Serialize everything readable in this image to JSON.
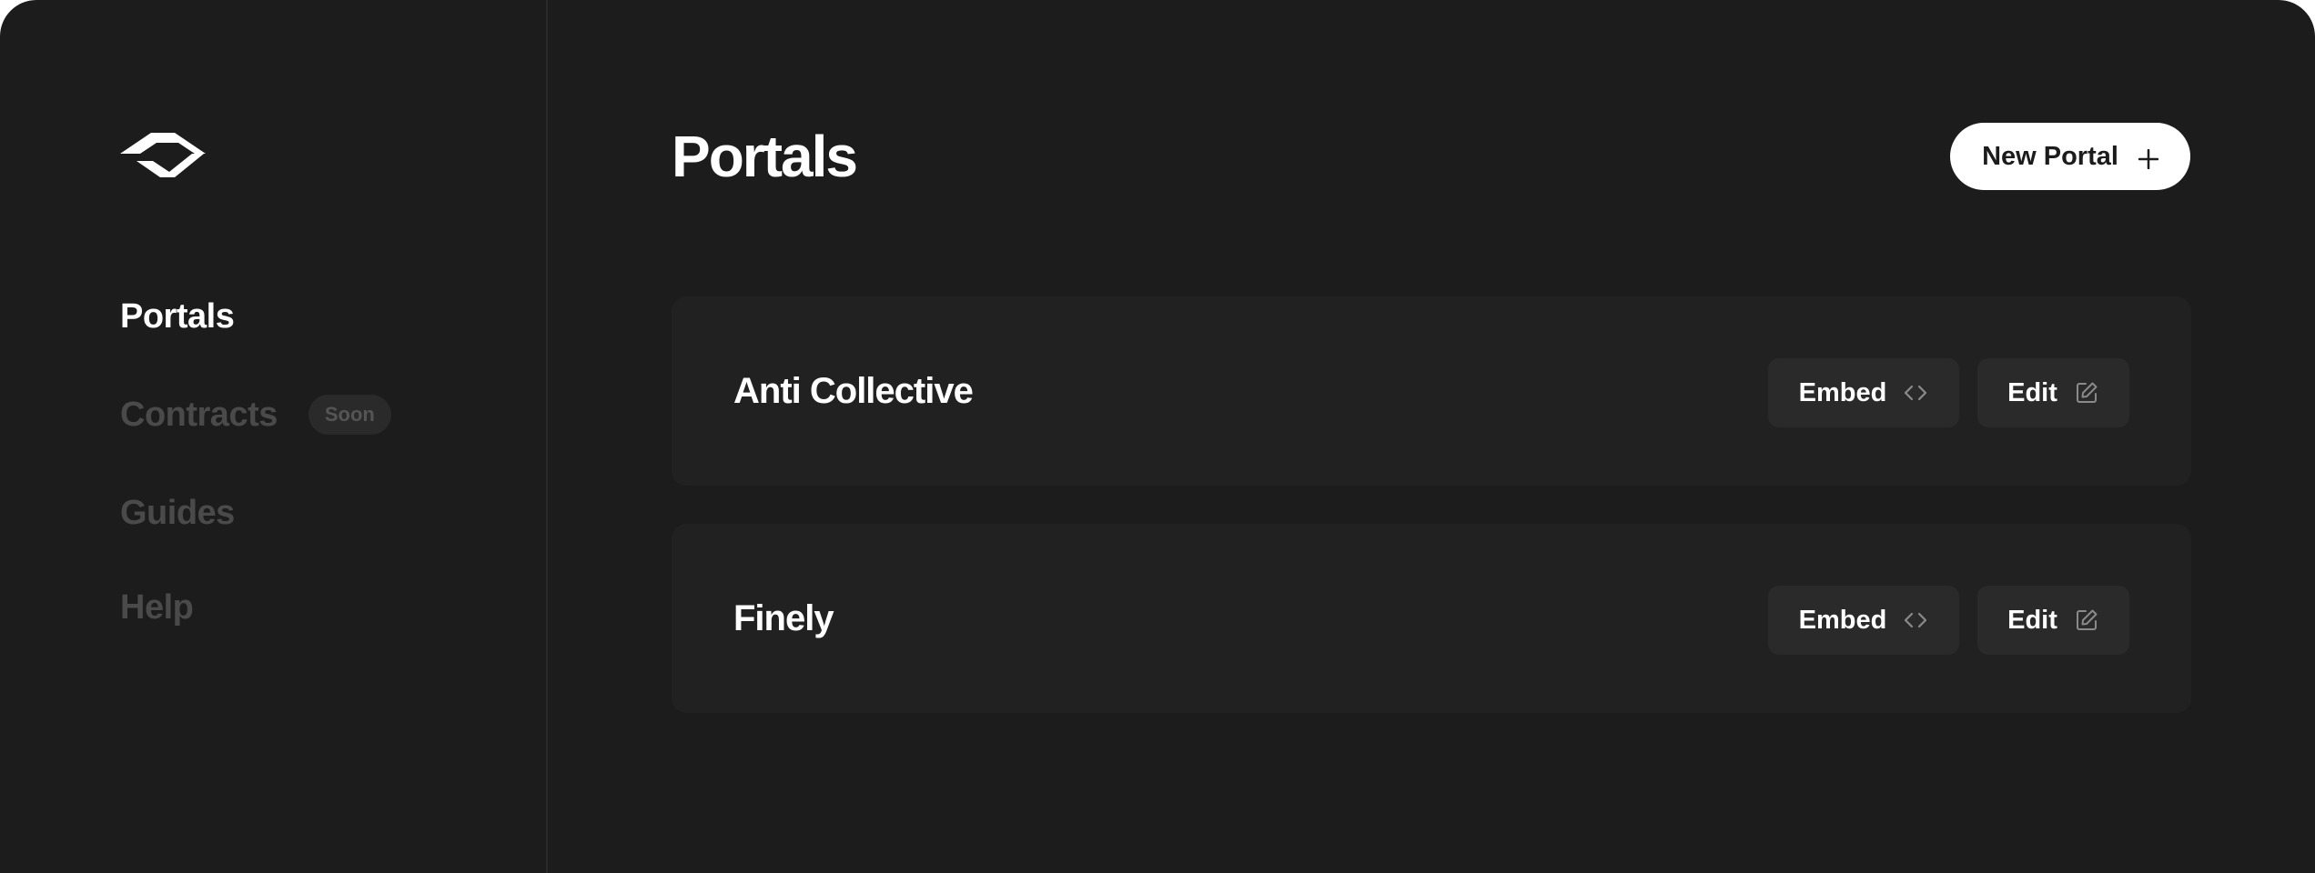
{
  "sidebar": {
    "logo": "portal-logo-icon",
    "items": [
      {
        "label": "Portals",
        "active": true
      },
      {
        "label": "Contracts",
        "active": false,
        "badge": "Soon"
      },
      {
        "label": "Guides",
        "active": false
      },
      {
        "label": "Help",
        "active": false
      }
    ]
  },
  "header": {
    "title": "Portals",
    "new_button_label": "New Portal",
    "new_button_icon": "plus-icon"
  },
  "portals": [
    {
      "name": "Anti Collective",
      "embed_label": "Embed",
      "embed_icon": "code-icon",
      "edit_label": "Edit",
      "edit_icon": "edit-icon"
    },
    {
      "name": "Finely",
      "embed_label": "Embed",
      "embed_icon": "code-icon",
      "edit_label": "Edit",
      "edit_icon": "edit-icon"
    }
  ],
  "colors": {
    "background": "#1c1c1c",
    "card": "#212121",
    "button": "#2a2a2a",
    "text_active": "#ffffff",
    "text_inactive": "#4a4a4a",
    "primary_button": "#ffffff"
  }
}
